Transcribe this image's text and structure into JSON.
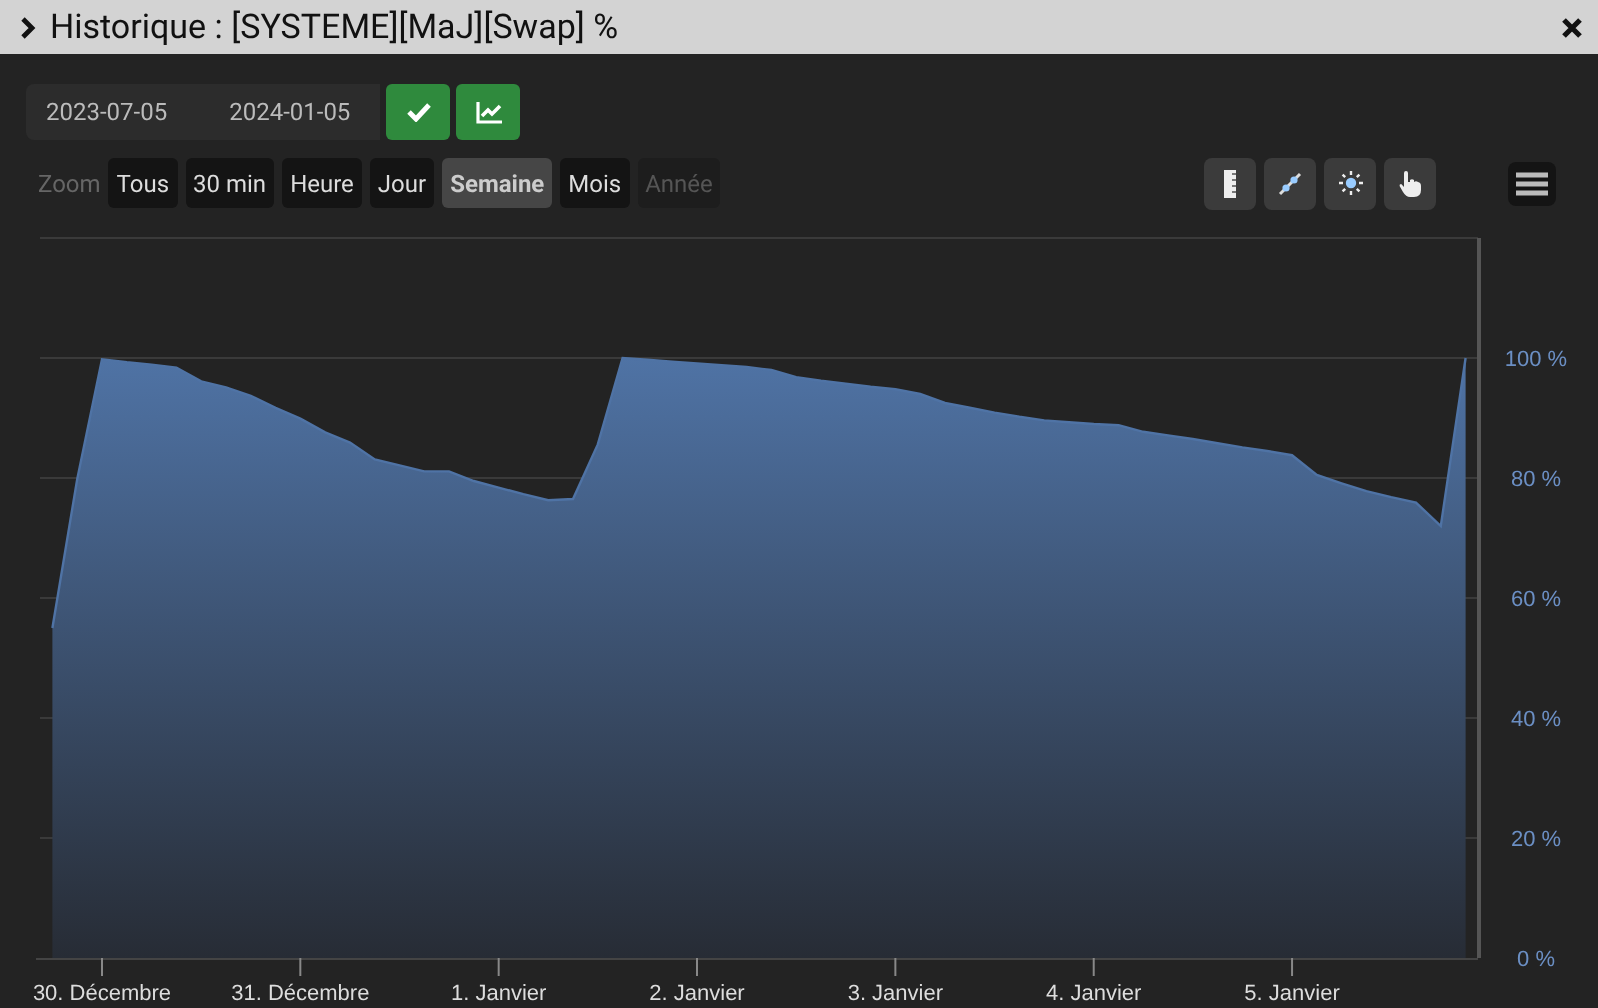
{
  "window": {
    "title": "Historique : [SYSTEME][MaJ][Swap] %"
  },
  "date_range": {
    "start": "2023-07-05",
    "end": "2024-01-05"
  },
  "zoom": {
    "label": "Zoom",
    "options": [
      {
        "label": "Tous",
        "selected": false,
        "disabled": false
      },
      {
        "label": "30 min",
        "selected": false,
        "disabled": false
      },
      {
        "label": "Heure",
        "selected": false,
        "disabled": false
      },
      {
        "label": "Jour",
        "selected": false,
        "disabled": false
      },
      {
        "label": "Semaine",
        "selected": true,
        "disabled": false
      },
      {
        "label": "Mois",
        "selected": false,
        "disabled": false
      },
      {
        "label": "Année",
        "selected": false,
        "disabled": true
      }
    ]
  },
  "chart": {
    "chart_data": {
      "type": "area",
      "grid": true,
      "ylim": [
        0,
        120
      ],
      "categories": [
        null,
        null,
        "30. Décembre",
        null,
        null,
        null,
        null,
        null,
        null,
        null,
        "31. Décembre",
        null,
        null,
        null,
        null,
        null,
        null,
        null,
        "1. Janvier",
        null,
        null,
        null,
        null,
        null,
        null,
        null,
        "2. Janvier",
        null,
        null,
        null,
        null,
        null,
        null,
        null,
        "3. Janvier",
        null,
        null,
        null,
        null,
        null,
        null,
        null,
        "4. Janvier",
        null,
        null,
        null,
        null,
        null,
        null,
        null,
        "5. Janvier",
        null,
        null,
        null,
        null,
        null,
        null,
        null
      ],
      "yticks": [
        {
          "value": 0,
          "label": "0 %"
        },
        {
          "value": 20,
          "label": "20 %"
        },
        {
          "value": 40,
          "label": "40 %"
        },
        {
          "value": 60,
          "label": "60 %"
        },
        {
          "value": 80,
          "label": "80 %"
        },
        {
          "value": 100,
          "label": "100 %"
        }
      ],
      "series": [
        {
          "color": "#4f73a5",
          "values": [
            55,
            79.8,
            99.8,
            99.3,
            98.9,
            98.4,
            96.1,
            95.1,
            93.7,
            91.7,
            89.9,
            87.6,
            85.9,
            83.1,
            82.1,
            81.1,
            81.1,
            79.5,
            78.4,
            77.3,
            76.3,
            76.5,
            85.6,
            100,
            99.7,
            99.4,
            99.1,
            98.8,
            98.5,
            98,
            96.8,
            96.2,
            95.7,
            95.2,
            94.8,
            94,
            92.5,
            91.7,
            90.9,
            90.2,
            89.6,
            89.3,
            89,
            88.8,
            87.7,
            87.1,
            86.5,
            85.8,
            85.1,
            84.5,
            83.8,
            80.5,
            79.1,
            77.8,
            76.8,
            75.9,
            72,
            100
          ]
        }
      ]
    }
  }
}
